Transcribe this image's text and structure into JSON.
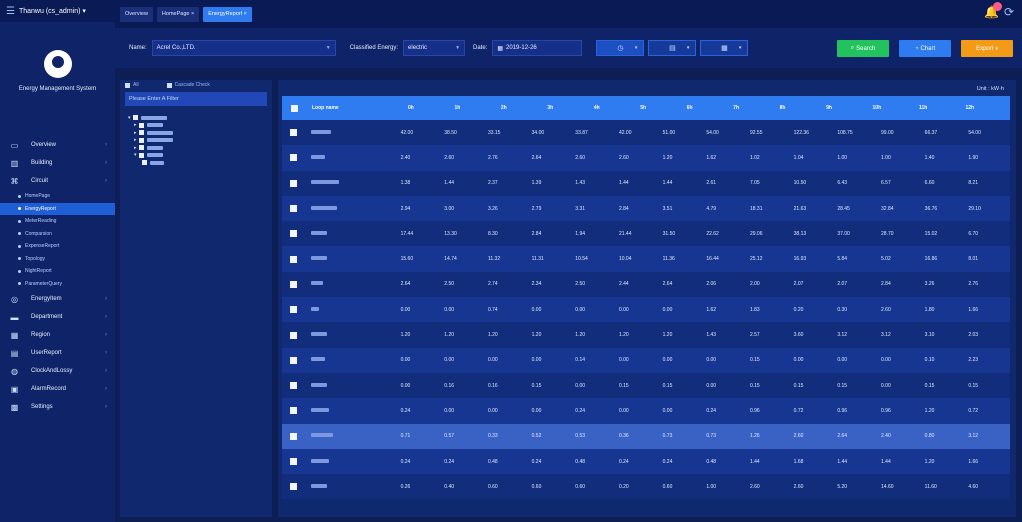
{
  "app": {
    "header_label": "Thanwu (cs_admin) ▾",
    "brand_name": "Energy Management System"
  },
  "tabs": [
    {
      "label": "Overview",
      "active": false
    },
    {
      "label": "HomePage ×",
      "active": false
    },
    {
      "label": "EnergyReport ×",
      "active": true
    }
  ],
  "sidebar": {
    "items": [
      {
        "label": "Overview",
        "icon": "monitor-icon"
      },
      {
        "label": "Building",
        "icon": "building-icon"
      },
      {
        "label": "Circuit",
        "icon": "circuit-icon"
      }
    ],
    "subitems": [
      {
        "label": "HomePage",
        "active": false
      },
      {
        "label": "EnergyReport",
        "active": true
      },
      {
        "label": "MeterReading",
        "active": false
      },
      {
        "label": "Comparsion",
        "active": false
      },
      {
        "label": "ExpenseReport",
        "active": false
      },
      {
        "label": "Topology",
        "active": false
      },
      {
        "label": "NightReport",
        "active": false
      },
      {
        "label": "ParameterQuery",
        "active": false
      }
    ],
    "items_after": [
      {
        "label": "EnergyItem",
        "icon": "target-icon"
      },
      {
        "label": "Department",
        "icon": "folder-icon"
      },
      {
        "label": "Region",
        "icon": "region-icon"
      },
      {
        "label": "UserReport",
        "icon": "report-icon"
      },
      {
        "label": "ClockAndLossy",
        "icon": "gauge-icon"
      },
      {
        "label": "AlarmRecord",
        "icon": "alarm-record-icon"
      },
      {
        "label": "Settings",
        "icon": "settings-icon"
      }
    ]
  },
  "filter": {
    "name_label": "Name:",
    "name_value": "Acrel Co.,LTD.",
    "energy_label": "Classified Energy:",
    "energy_value": "electric",
    "date_label": "Date:",
    "date_value": "2019-12-26",
    "search_label": "Search",
    "chart_label": "Chart",
    "export_label": "Export"
  },
  "tree": {
    "all_label": "All",
    "cascade_label": "Cascade Check",
    "filter_placeholder": "Please Enter A Filter"
  },
  "table": {
    "unit": "Unit : kW·h",
    "headers": [
      "Loop name",
      "0h",
      "1h",
      "2h",
      "3h",
      "4h",
      "5h",
      "6h",
      "7h",
      "8h",
      "9h",
      "10h",
      "11h",
      "12h"
    ],
    "rows": [
      [
        "42.00",
        "38.50",
        "33.15",
        "34.00",
        "33.87",
        "42.00",
        "51.00",
        "54.00",
        "92.55",
        "122.36",
        "108.75",
        "99.00",
        "66.37",
        "54.00"
      ],
      [
        "2.40",
        "2.60",
        "2.76",
        "2.64",
        "2.60",
        "2.60",
        "1.20",
        "1.62",
        "1.02",
        "1.04",
        "1.00",
        "1.00",
        "1.40",
        "1.90"
      ],
      [
        "1.38",
        "1.44",
        "2.37",
        "1.39",
        "1.43",
        "1.44",
        "1.44",
        "2.61",
        "7.05",
        "10.50",
        "6.43",
        "6.57",
        "6.60",
        "8.21"
      ],
      [
        "2.94",
        "3.00",
        "3.26",
        "2.79",
        "3.31",
        "2.84",
        "3.51",
        "4.79",
        "18.31",
        "21.63",
        "28.45",
        "32.84",
        "36.76",
        "29.10"
      ],
      [
        "17.44",
        "13.30",
        "8.30",
        "2.84",
        "1.94",
        "21.44",
        "31.50",
        "22.62",
        "29.06",
        "38.13",
        "37.00",
        "28.70",
        "15.02",
        "6.70"
      ],
      [
        "15.60",
        "14.74",
        "11.32",
        "11.31",
        "10.54",
        "10.04",
        "11.36",
        "16.44",
        "25.12",
        "16.93",
        "5.84",
        "5.02",
        "16.86",
        "8.01"
      ],
      [
        "2.64",
        "2.50",
        "2.74",
        "2.34",
        "2.50",
        "2.44",
        "2.64",
        "2.06",
        "2.00",
        "2.07",
        "2.07",
        "2.84",
        "3.26",
        "2.76"
      ],
      [
        "0.00",
        "0.00",
        "0.74",
        "0.00",
        "0.00",
        "0.00",
        "0.00",
        "1.62",
        "1.83",
        "0.20",
        "0.30",
        "2.60",
        "1.80",
        "1.66"
      ],
      [
        "1.20",
        "1.20",
        "1.20",
        "1.20",
        "1.20",
        "1.20",
        "1.20",
        "1.43",
        "2.57",
        "3.60",
        "3.12",
        "3.12",
        "3.10",
        "2.03"
      ],
      [
        "0.00",
        "0.00",
        "0.00",
        "0.00",
        "0.14",
        "0.00",
        "0.00",
        "0.00",
        "0.15",
        "0.00",
        "0.00",
        "0.00",
        "0.10",
        "2.23"
      ],
      [
        "0.00",
        "0.16",
        "0.16",
        "0.15",
        "0.00",
        "0.15",
        "0.15",
        "0.00",
        "0.15",
        "0.15",
        "0.15",
        "0.00",
        "0.15",
        "0.15"
      ],
      [
        "0.24",
        "0.00",
        "0.00",
        "0.00",
        "0.24",
        "0.00",
        "0.00",
        "0.24",
        "0.96",
        "0.72",
        "0.96",
        "0.96",
        "1.20",
        "0.72"
      ],
      [
        "0.71",
        "0.57",
        "0.33",
        "0.52",
        "0.53",
        "0.36",
        "0.73",
        "0.73",
        "1.26",
        "2.60",
        "2.64",
        "2.40",
        "0.80",
        "3.12"
      ],
      [
        "0.24",
        "0.24",
        "0.48",
        "0.24",
        "0.48",
        "0.24",
        "0.24",
        "0.48",
        "1.44",
        "1.68",
        "1.44",
        "1.44",
        "1.20",
        "1.66"
      ],
      [
        "0.26",
        "0.40",
        "0.60",
        "0.60",
        "0.60",
        "0.20",
        "0.60",
        "1.00",
        "2.60",
        "2.60",
        "5.20",
        "14.60",
        "11.60",
        "4.60"
      ]
    ],
    "selected_row": 12
  },
  "colors": {
    "accent": "#2f7bf0",
    "search_btn": "#22c35e",
    "chart_btn": "#2f7bf0",
    "export_btn": "#f39a16"
  }
}
